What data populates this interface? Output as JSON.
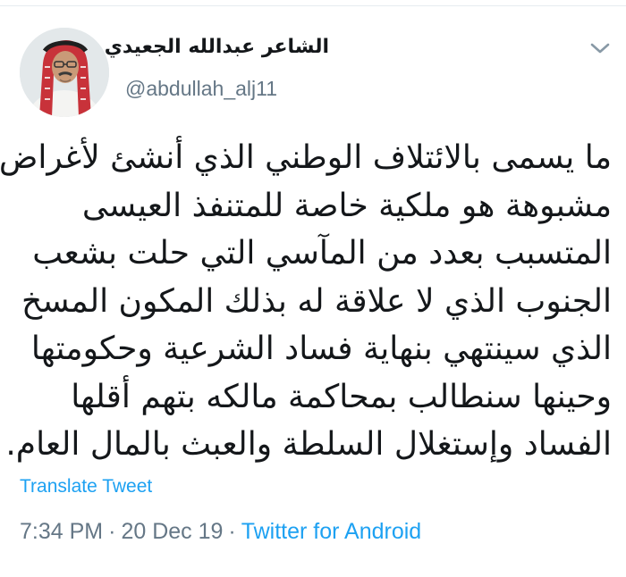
{
  "author": {
    "display_name": "الشاعر عبدالله الجعيدي",
    "handle": "@abdullah_alj11"
  },
  "menu_icon": "chevron-down-icon",
  "tweet": {
    "lines": [
      "ما يسمى بالائتلاف الوطني الذي أنشئ لأغراض",
      "مشبوهة هو ملكية خاصة للمتنفذ العيسى",
      "المتسبب بعدد من المآسي التي حلت بشعب",
      "الجنوب الذي لا علاقة له بذلك المكون المسخ",
      "الذي سينتهي بنهاية فساد الشرعية وحكومتها",
      "وحينها سنطالب بمحاكمة مالكه بتهم أقلها",
      "الفساد وإستغلال السلطة والعبث بالمال العام."
    ]
  },
  "translate_label": "Translate Tweet",
  "meta": {
    "time": "7:34 PM",
    "separator": "·",
    "date": "20 Dec 19",
    "source": "Twitter for Android"
  },
  "colors": {
    "link": "#1da1f2",
    "secondary": "#657786",
    "text": "#14171a"
  }
}
